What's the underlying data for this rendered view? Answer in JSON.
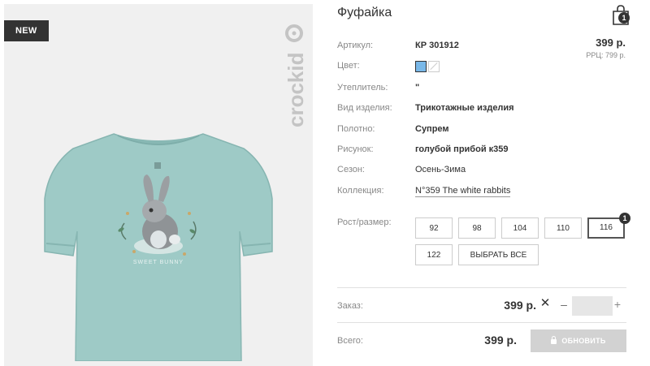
{
  "product": {
    "badge": "NEW",
    "brand": "crockid",
    "title": "Фуфайка",
    "cart_count": "1",
    "price": "399 р.",
    "rrp": "РРЦ: 799 р."
  },
  "attributes": [
    {
      "label": "Артикул:",
      "value": "КР 301912"
    },
    {
      "label": "Цвет:",
      "value": ""
    },
    {
      "label": "Утеплитель:",
      "value": "\""
    },
    {
      "label": "Вид изделия:",
      "value": "Трикотажные изделия"
    },
    {
      "label": "Полотно:",
      "value": "Супрем"
    },
    {
      "label": "Рисунок:",
      "value": "голубой прибой к359"
    },
    {
      "label": "Сезон:",
      "value": "Осень-Зима"
    },
    {
      "label": "Коллекция:",
      "value": "N°359 The white rabbits"
    }
  ],
  "colors": [
    "#79b8e8",
    "#ffffff"
  ],
  "sizes": {
    "label": "Рост/размер:",
    "options": [
      "92",
      "98",
      "104",
      "110",
      "116",
      "122"
    ],
    "selected": "116",
    "selected_count": "1",
    "select_all": "ВЫБРАТЬ ВСЕ"
  },
  "order": {
    "label": "Заказ:",
    "price": "399 р.",
    "remove": "✕",
    "minus": "–",
    "plus": "+",
    "quantity": ""
  },
  "total": {
    "label": "Всего:",
    "price": "399 р.",
    "button": "ОБНОВИТЬ"
  },
  "print_text": "SWEET BUNNY"
}
